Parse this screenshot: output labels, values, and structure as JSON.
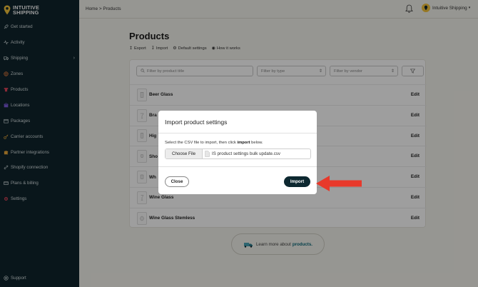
{
  "app": {
    "brand_line1": "INTUITIVE",
    "brand_line2": "SHIPPING",
    "brand_color": "#f2c23a",
    "sidebar_bg": "#0f252d"
  },
  "sidebar": {
    "items": [
      {
        "label": "Get started",
        "icon": "rocket-icon"
      },
      {
        "label": "Activity",
        "icon": "activity-icon"
      },
      {
        "label": "Shipping",
        "icon": "truck-icon",
        "has_chevron": true
      },
      {
        "label": "Zones",
        "icon": "globe-icon"
      },
      {
        "label": "Products",
        "icon": "shirt-icon"
      },
      {
        "label": "Locations",
        "icon": "building-icon"
      },
      {
        "label": "Packages",
        "icon": "package-icon"
      },
      {
        "label": "Carrier accounts",
        "icon": "key-icon"
      },
      {
        "label": "Partner integrations",
        "icon": "puzzle-icon"
      },
      {
        "label": "Shopify connection",
        "icon": "link-icon"
      },
      {
        "label": "Plans & billing",
        "icon": "card-icon"
      },
      {
        "label": "Settings",
        "icon": "gear-icon"
      }
    ],
    "support_label": "Support"
  },
  "topbar": {
    "breadcrumb": "Home > Products",
    "account_name": "Intuitive Shipping",
    "account_caret": "▾"
  },
  "page": {
    "title": "Products",
    "actions": [
      {
        "glyph": "↥",
        "label": "Export"
      },
      {
        "glyph": "↧",
        "label": "Import"
      },
      {
        "glyph": "⚙",
        "label": "Default settings"
      },
      {
        "glyph": "◉",
        "label": "How it works"
      }
    ]
  },
  "filters": {
    "title_placeholder": "Filter by product title",
    "type_placeholder": "Filter by type",
    "vendor_placeholder": "Filter by vendor"
  },
  "products": [
    {
      "name": "Beer Glass",
      "edit": "Edit"
    },
    {
      "name": "Bra",
      "edit": "Edit"
    },
    {
      "name": "Hig",
      "edit": "Edit"
    },
    {
      "name": "Sho",
      "edit": "Edit"
    },
    {
      "name": "Wh",
      "edit": "Edit"
    },
    {
      "name": "Wine Glass",
      "edit": "Edit"
    },
    {
      "name": "Wine Glass Stemless",
      "edit": "Edit"
    }
  ],
  "learn_more": {
    "prefix": "Learn more about",
    "link": "products."
  },
  "modal": {
    "title": "Import product settings",
    "instruction_pre": "Select the CSV file to import, then click ",
    "instruction_bold": "import",
    "instruction_post": " below.",
    "choose_file_label": "Choose File",
    "file_name": "IS product settings bulk update.csv",
    "close_label": "Close",
    "import_label": "Import"
  },
  "annotation": {
    "arrow_color": "#e8392b"
  }
}
